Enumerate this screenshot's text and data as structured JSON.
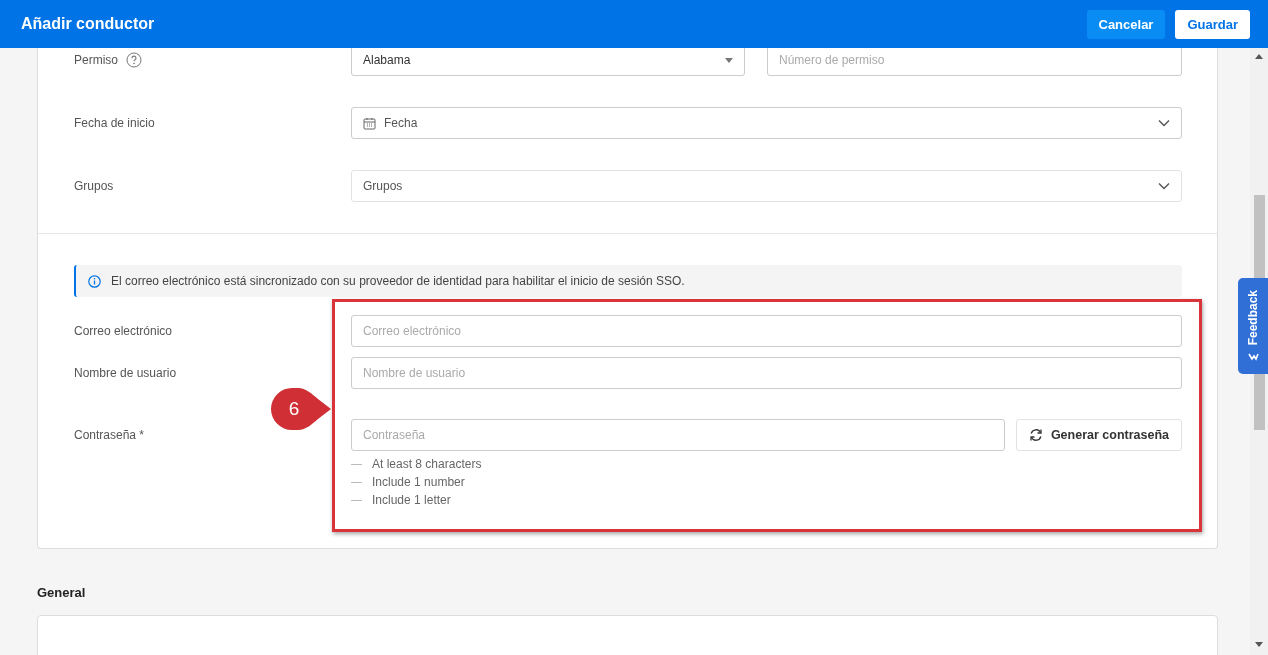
{
  "header": {
    "title": "Añadir conductor",
    "buttons": [
      {
        "label": "Cancelar",
        "kind": "secondary"
      },
      {
        "label": "Guardar",
        "kind": "primary"
      }
    ]
  },
  "form": {
    "rows": [
      {
        "label": "Permiso",
        "help": true,
        "kind": "license",
        "value": "Alabama",
        "placeholder": "Número de permiso"
      },
      {
        "label": "Fecha de inicio",
        "help": false,
        "kind": "date",
        "placeholder": "Fecha"
      },
      {
        "label": "Grupos",
        "help": false,
        "kind": "dropdown",
        "placeholder": "Grupos"
      }
    ],
    "info": "El correo electrónico está sincronizado con su proveedor de identidad para habilitar el inicio de sesión SSO.",
    "login_rows": [
      {
        "label": "Correo electrónico",
        "kind": "text",
        "placeholder": "Correo electrónico"
      },
      {
        "label": "Nombre de usuario",
        "kind": "text",
        "placeholder": "Nombre de usuario"
      },
      {
        "label": "Contraseña *",
        "kind": "password",
        "placeholder": "Contraseña",
        "button": "Generar contraseña",
        "requirements": [
          "At least 8 characters",
          "Include 1 number",
          "Include 1 letter"
        ]
      }
    ]
  },
  "sections": [
    {
      "title": "General"
    }
  ],
  "annotation": {
    "number": "6"
  },
  "feedback_tab": {
    "label": "Feedback"
  }
}
